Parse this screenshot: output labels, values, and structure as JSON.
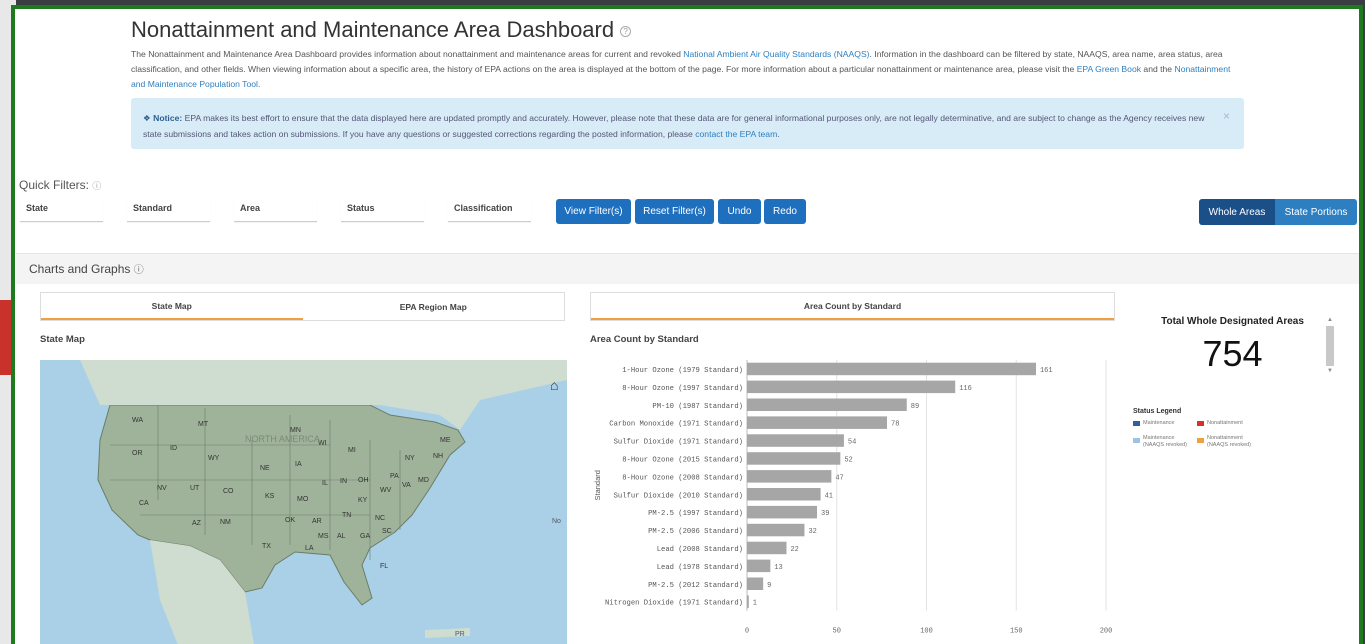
{
  "page": {
    "title": "Nonattainment and Maintenance Area Dashboard",
    "intro_1": "The Nonattainment and Maintenance Area Dashboard provides information about nonattainment and maintenance areas for current and revoked ",
    "intro_link_naaqs": "National Ambient Air Quality Standards (NAAQS)",
    "intro_2": ". Information in the dashboard can be filtered by state, NAAQS, area name, area status, area classification, and other fields. When viewing information about a specific area, the history of EPA actions on the area is displayed at the bottom of the page. For more information about a particular nonattainment or maintenance area, please visit the ",
    "intro_link_greenbook": "EPA Green Book",
    "intro_3": " and the ",
    "intro_link_poptool": "Nonattainment and Maintenance Population Tool",
    "intro_4": "."
  },
  "notice": {
    "label": "Notice:",
    "text": " EPA makes its best effort to ensure that the data displayed here are updated promptly and accurately. However, please note that these data are for general informational purposes only, are not legally determinative, and are subject to change as the Agency receives new state submissions and takes action on submissions. If you have any questions or suggested corrections regarding the posted information, please ",
    "link": "contact the EPA team",
    "end": ".",
    "close": "×"
  },
  "filters": {
    "label": "Quick Filters:",
    "fields": [
      "State",
      "Standard",
      "Area",
      "Status",
      "Classification"
    ],
    "buttons": [
      "View Filter(s)",
      "Reset Filter(s)",
      "Undo",
      "Redo"
    ],
    "toggle": [
      "Whole Areas",
      "State Portions"
    ]
  },
  "section": {
    "title": "Charts and Graphs"
  },
  "map_panel": {
    "tabs": [
      "State Map",
      "EPA Region Map"
    ],
    "subtitle": "State Map",
    "labels": [
      "WA",
      "MT",
      "OR",
      "ID",
      "WY",
      "NE",
      "IA",
      "MN",
      "WI",
      "MI",
      "NY",
      "ME",
      "NH",
      "PA",
      "NV",
      "UT",
      "CO",
      "KS",
      "MO",
      "IL",
      "IN",
      "OH",
      "WV",
      "VA",
      "MD",
      "CA",
      "AZ",
      "NM",
      "OK",
      "AR",
      "KY",
      "TN",
      "NC",
      "SC",
      "GA",
      "AL",
      "MS",
      "LA",
      "TX",
      "FL",
      "NORTH AMERICA",
      "No",
      "PR"
    ]
  },
  "chart_panel": {
    "tab": "Area Count by Standard",
    "subtitle": "Area Count by Standard"
  },
  "chart_data": {
    "type": "bar",
    "orientation": "horizontal",
    "title": "Area Count by Standard",
    "ylabel": "Standard",
    "xlabel": "",
    "categories": [
      "1-Hour Ozone (1979 Standard)",
      "8-Hour Ozone (1997 Standard)",
      "PM-10 (1987 Standard)",
      "Carbon Monoxide (1971 Standard)",
      "Sulfur Dioxide (1971 Standard)",
      "8-Hour Ozone (2015 Standard)",
      "8-Hour Ozone (2008 Standard)",
      "Sulfur Dioxide (2010 Standard)",
      "PM-2.5 (1997 Standard)",
      "PM-2.5 (2006 Standard)",
      "Lead (2008 Standard)",
      "Lead (1978 Standard)",
      "PM-2.5 (2012 Standard)",
      "Nitrogen Dioxide (1971 Standard)"
    ],
    "values": [
      161,
      116,
      89,
      78,
      54,
      52,
      47,
      41,
      39,
      32,
      22,
      13,
      9,
      1
    ],
    "xlim": [
      0,
      200
    ],
    "xticks": [
      0,
      50,
      100,
      150,
      200
    ],
    "grid": true,
    "bar_color": "#a6a6a6"
  },
  "kpi": {
    "title": "Total Whole Designated Areas",
    "value": "754"
  },
  "legend": {
    "title": "Status Legend",
    "items": [
      {
        "label": "Maintenance",
        "color": "#2f5fa0"
      },
      {
        "label": "Nonattainment",
        "color": "#d9312a"
      },
      {
        "label": "Maintenance (NAAQS revoked)",
        "color": "#9cc3e4"
      },
      {
        "label": "Nonattainment (NAAQS revoked)",
        "color": "#f0a040"
      }
    ]
  }
}
